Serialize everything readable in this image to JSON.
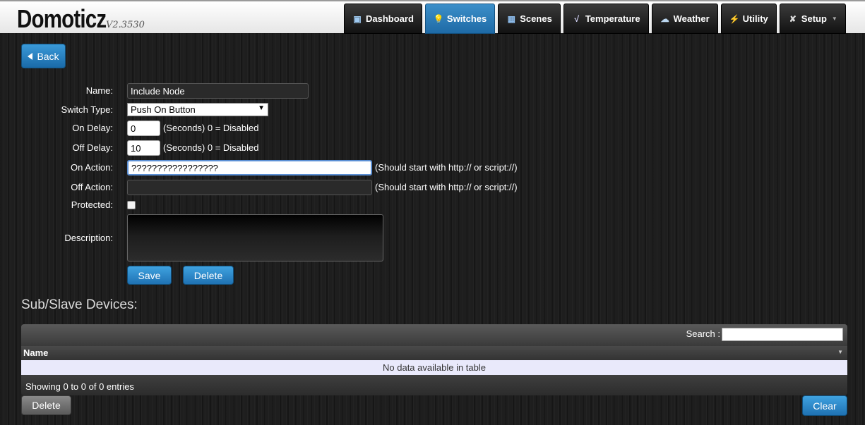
{
  "header": {
    "brand": "Domoticz",
    "version": "V2.3530",
    "nav": [
      {
        "label": "Dashboard",
        "icon": "dashboard-icon"
      },
      {
        "label": "Switches",
        "icon": "lightbulb-icon",
        "active": true
      },
      {
        "label": "Scenes",
        "icon": "clapperboard-icon"
      },
      {
        "label": "Temperature",
        "icon": "thermometer-icon"
      },
      {
        "label": "Weather",
        "icon": "weather-cloud-icon"
      },
      {
        "label": "Utility",
        "icon": "lightning-icon"
      },
      {
        "label": "Setup",
        "icon": "tools-icon"
      }
    ]
  },
  "back_label": "Back",
  "form": {
    "name_label": "Name:",
    "name_value": "Include Node",
    "switch_type_label": "Switch Type:",
    "switch_type_value": "Push On Button",
    "on_delay_label": "On Delay:",
    "on_delay_value": "0",
    "on_delay_hint": "(Seconds) 0 = Disabled",
    "off_delay_label": "Off Delay:",
    "off_delay_value": "10",
    "off_delay_hint": "(Seconds) 0 = Disabled",
    "on_action_label": "On Action:",
    "on_action_value": "?????????????????",
    "on_action_hint": "(Should start with http:// or script://)",
    "off_action_label": "Off Action:",
    "off_action_value": "",
    "off_action_hint": "(Should start with http:// or script://)",
    "protected_label": "Protected:",
    "protected_checked": false,
    "description_label": "Description:",
    "description_value": "",
    "save_label": "Save",
    "delete_label": "Delete"
  },
  "sub_devices": {
    "title": "Sub/Slave Devices:",
    "search_label": "Search :",
    "search_value": "",
    "column_name": "Name",
    "empty_text": "No data available in table",
    "footer_info": "Showing 0 to 0 of 0 entries",
    "delete_label": "Delete",
    "clear_label": "Clear"
  },
  "colors": {
    "accent_blue": "#2a86c8",
    "header_bg": "#f2f2f2",
    "body_bg": "#1e1e1e"
  }
}
